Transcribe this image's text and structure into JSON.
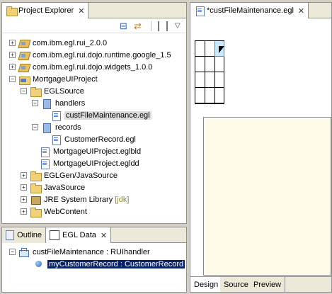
{
  "explorer": {
    "title": "Project Explorer",
    "close": "✕",
    "toolbar": {
      "collapse": "⊟",
      "link": "⇄",
      "menu": "▽"
    },
    "items": [
      {
        "label": "com.ibm.egl.rui_2.0.0",
        "toggle": "+"
      },
      {
        "label": "com.ibm.egl.rui.dojo.runtime.google_1.5",
        "toggle": "+"
      },
      {
        "label": "com.ibm.egl.rui.dojo.widgets_1.0.0",
        "toggle": "+"
      },
      {
        "label": "MortgageUIProject",
        "toggle": "−"
      },
      {
        "label": "EGLSource",
        "toggle": "−"
      },
      {
        "label": "handlers",
        "toggle": "−"
      },
      {
        "label": "custFileMaintenance.egl"
      },
      {
        "label": "records",
        "toggle": "−"
      },
      {
        "label": "CustomerRecord.egl"
      },
      {
        "label": "MortgageUIProject.eglbld"
      },
      {
        "label": "MortgageUIProject.egldd"
      },
      {
        "label": "EGLGen/JavaSource",
        "toggle": "+"
      },
      {
        "label": "JavaSource",
        "toggle": "+"
      },
      {
        "label": "JRE System Library",
        "suffix": "[jdk]",
        "toggle": "+"
      },
      {
        "label": "WebContent",
        "toggle": "+"
      }
    ]
  },
  "bottom": {
    "tabs": [
      {
        "label": "Outline"
      },
      {
        "label": "EGL Data",
        "close": "✕"
      }
    ],
    "items": [
      {
        "label": "custFileMaintenance : RUIhandler",
        "toggle": "−"
      },
      {
        "label": "myCustomerRecord : CustomerRecord"
      }
    ]
  },
  "editor": {
    "tab_label": "*custFileMaintenance.egl",
    "close": "✕",
    "bottom_tabs": [
      "Design",
      "Source",
      "Preview"
    ]
  },
  "colors": {
    "selection": "#0a246a",
    "panel_bg": "#ffffff",
    "chrome_bg": "#d4d0c8"
  }
}
